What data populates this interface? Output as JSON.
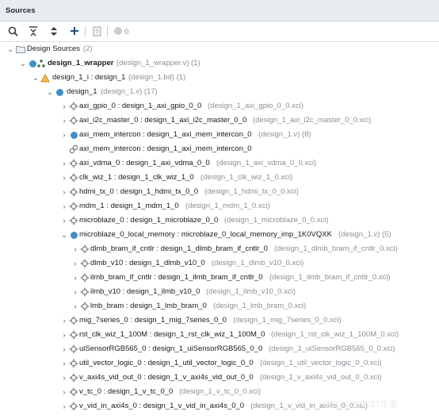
{
  "panel": {
    "title": "Sources"
  },
  "toolbar": {
    "search_icon": "search-icon",
    "collapse_all_icon": "collapse-all-icon",
    "expand_all_icon": "expand-all-icon",
    "add_icon": "add-icon",
    "properties_icon": "file-properties-icon",
    "status_count": "0"
  },
  "tree": {
    "root_label": "Design Sources",
    "root_count": "(2)",
    "wrapper_name": "design_1_wrapper",
    "wrapper_file": "(design_1_wrapper.v) (1)",
    "bd_name": "design_1_i : design_1",
    "bd_file": "(design_1.bd) (1)",
    "design_name": "design_1",
    "design_file": "(design_1.v) (17)",
    "items": [
      {
        "name": "axi_gpio_0 : design_1_axi_gpio_0_0",
        "file": "(design_1_axi_gpio_0_0.xci)"
      },
      {
        "name": "axi_i2c_master_0 : design_1_axi_i2c_master_0_0",
        "file": "(design_1_axi_i2c_master_0_0.xci)"
      },
      {
        "name": "axi_mem_intercon : design_1_axi_mem_intercon_0",
        "file": "(design_1.v) (8)"
      },
      {
        "name": "axi_mem_intercon : design_1_axi_mem_intercon_0",
        "file": ""
      },
      {
        "name": "axi_vdma_0 : design_1_axi_vdma_0_0",
        "file": "(design_1_axi_vdma_0_0.xci)"
      },
      {
        "name": "clk_wiz_1 : design_1_clk_wiz_1_0",
        "file": "(design_1_clk_wiz_1_0.xci)"
      },
      {
        "name": "hdmi_tx_0 : design_1_hdmi_tx_0_0",
        "file": "(design_1_hdmi_tx_0_0.xci)"
      },
      {
        "name": "mdm_1 : design_1_mdm_1_0",
        "file": "(design_1_mdm_1_0.xci)"
      },
      {
        "name": "microblaze_0 : design_1_microblaze_0_0",
        "file": "(design_1_microblaze_0_0.xci)"
      },
      {
        "name": "microblaze_0_local_memory : microblaze_0_local_memory_imp_1K0VQXK",
        "file": "(design_1.v) (5)"
      },
      {
        "name": "dlmb_bram_if_cntlr : design_1_dlmb_bram_if_cntlr_0",
        "file": "(design_1_dlmb_bram_if_cntlr_0.xci)"
      },
      {
        "name": "dlmb_v10 : design_1_dlmb_v10_0",
        "file": "(design_1_dlmb_v10_0.xci)"
      },
      {
        "name": "ilmb_bram_if_cntlr : design_1_ilmb_bram_if_cntlr_0",
        "file": "(design_1_ilmb_bram_if_cntlr_0.xci)"
      },
      {
        "name": "ilmb_v10 : design_1_ilmb_v10_0",
        "file": "(design_1_ilmb_v10_0.xci)"
      },
      {
        "name": "lmb_bram : design_1_lmb_bram_0",
        "file": "(design_1_lmb_bram_0.xci)"
      },
      {
        "name": "mig_7series_0 : design_1_mig_7series_0_0",
        "file": "(design_1_mig_7series_0_0.xci)"
      },
      {
        "name": "rst_clk_wiz_1_100M : design_1_rst_clk_wiz_1_100M_0",
        "file": "(design_1_rst_clk_wiz_1_100M_0.xci)"
      },
      {
        "name": "uiSensorRGB565_0 : design_1_uiSensorRGB565_0_0",
        "file": "(design_1_uiSensorRGB565_0_0.xci)"
      },
      {
        "name": "util_vector_logic_0 : design_1_util_vector_logic_0_0",
        "file": "(design_1_util_vector_logic_0_0.xci)"
      },
      {
        "name": "v_axi4s_vid_out_0 : design_1_v_axi4s_vid_out_0_0",
        "file": "(design_1_v_axi4s_vid_out_0_0.xci)"
      },
      {
        "name": "v_tc_0 : design_1_v_tc_0_0",
        "file": "(design_1_v_tc_0_0.xci)"
      },
      {
        "name": "v_vid_in_axi4s_0 : design_1_v_vid_in_axi4s_0_0",
        "file": "(design_1_v_vid_in_axi4s_0_0.xci)"
      }
    ]
  },
  "watermark": "CSDN @9527华安",
  "colors": {
    "accent": "#3f8fc6",
    "bd_icon": "#e0a020",
    "header_bg": "#e8ecf1"
  }
}
